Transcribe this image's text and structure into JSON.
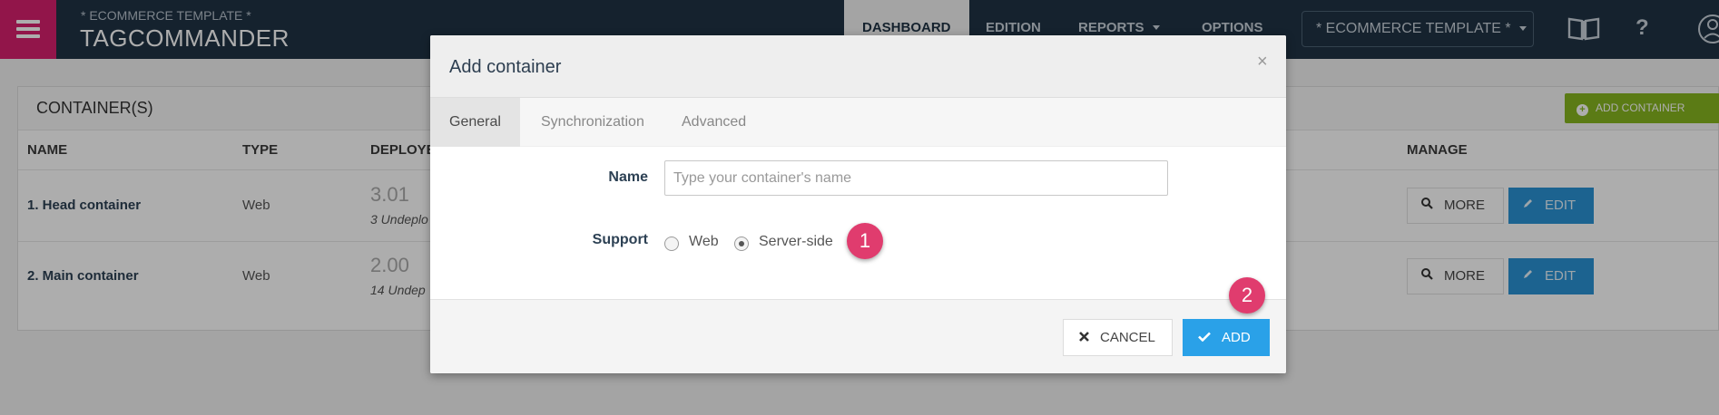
{
  "header": {
    "subtitle": "* ECOMMERCE TEMPLATE *",
    "title": "TAGCOMMANDER",
    "nav": {
      "dashboard": "DASHBOARD",
      "edition": "EDITION",
      "reports": "REPORTS",
      "options": "OPTIONS"
    },
    "account_select": "* ECOMMERCE TEMPLATE *",
    "help": "?"
  },
  "containers_panel": {
    "title": "CONTAINER(S)",
    "add_button": "ADD CONTAINER",
    "columns": {
      "name": "NAME",
      "type": "TYPE",
      "deployed": "DEPLOYE",
      "manage": "MANAGE"
    },
    "rows": [
      {
        "name": "1. Head container",
        "type": "Web",
        "version": "3.01",
        "undeployed": "3 Undeplo",
        "more": "MORE",
        "edit": "EDIT"
      },
      {
        "name": "2. Main container",
        "type": "Web",
        "version": "2.00",
        "undeployed": "14 Undep",
        "more": "MORE",
        "edit": "EDIT"
      }
    ]
  },
  "modal": {
    "title": "Add container",
    "close": "×",
    "tabs": {
      "general": "General",
      "synchronization": "Synchronization",
      "advanced": "Advanced"
    },
    "name_label": "Name",
    "name_placeholder": "Type your container's name",
    "support_label": "Support",
    "support_options": {
      "web": "Web",
      "server_side": "Server-side"
    },
    "selected_support": "Server-side",
    "cancel": "CANCEL",
    "add": "ADD"
  },
  "annotations": {
    "step1": "1",
    "step2": "2"
  },
  "colors": {
    "header_bg": "#1f3345",
    "accent_pink": "#d8206e",
    "add_container_green": "#86b520",
    "edit_blue": "#2a93d5",
    "add_blue": "#2aa1e8",
    "badge_pink": "#e03c6e"
  }
}
